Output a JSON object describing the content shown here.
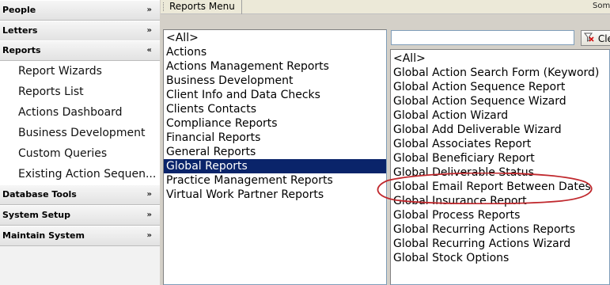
{
  "sidebar": {
    "sections_top": [
      {
        "label": "People",
        "chevron": "»"
      },
      {
        "label": "Letters",
        "chevron": "»"
      },
      {
        "label": "Reports",
        "chevron": "«"
      }
    ],
    "report_items": [
      "Report Wizards",
      "Reports List",
      "Actions Dashboard",
      "Business Development",
      "Custom Queries",
      "Existing  Action  Sequen..."
    ],
    "sections_bottom": [
      {
        "label": "Database Tools",
        "chevron": "»"
      },
      {
        "label": "System Setup",
        "chevron": "»"
      },
      {
        "label": "Maintain System",
        "chevron": "»"
      }
    ]
  },
  "toolbar": {
    "menu_title": "Reports Menu",
    "right_label": "Som"
  },
  "categories": {
    "items": [
      "<All>",
      "Actions",
      "Actions Management Reports",
      "Business Development",
      "Client Info and Data Checks",
      "Clients Contacts",
      "Compliance Reports",
      "Financial Reports",
      "General Reports",
      "Global Reports",
      "Practice Management Reports",
      "Virtual Work Partner Reports"
    ],
    "selected": "Global Reports"
  },
  "search": {
    "value": "",
    "clear_label": "Cle"
  },
  "reports": {
    "items": [
      "<All>",
      "Global Action Search Form (Keyword)",
      "Global Action Sequence Report",
      "Global Action Sequence Wizard",
      "Global Action Wizard",
      "Global Add Deliverable Wizard",
      "Global Associates Report",
      "Global Beneficiary Report",
      "Global Deliverable Status",
      "Global Email Report Between Dates",
      "Global Insurance Report",
      "Global Process Reports",
      "Global Recurring Actions Reports",
      "Global Recurring Actions Wizard",
      "Global Stock Options"
    ],
    "highlighted": "Global Email Report Between Dates"
  },
  "colors": {
    "selection": "#0a246a",
    "annotation": "#c0282d"
  }
}
